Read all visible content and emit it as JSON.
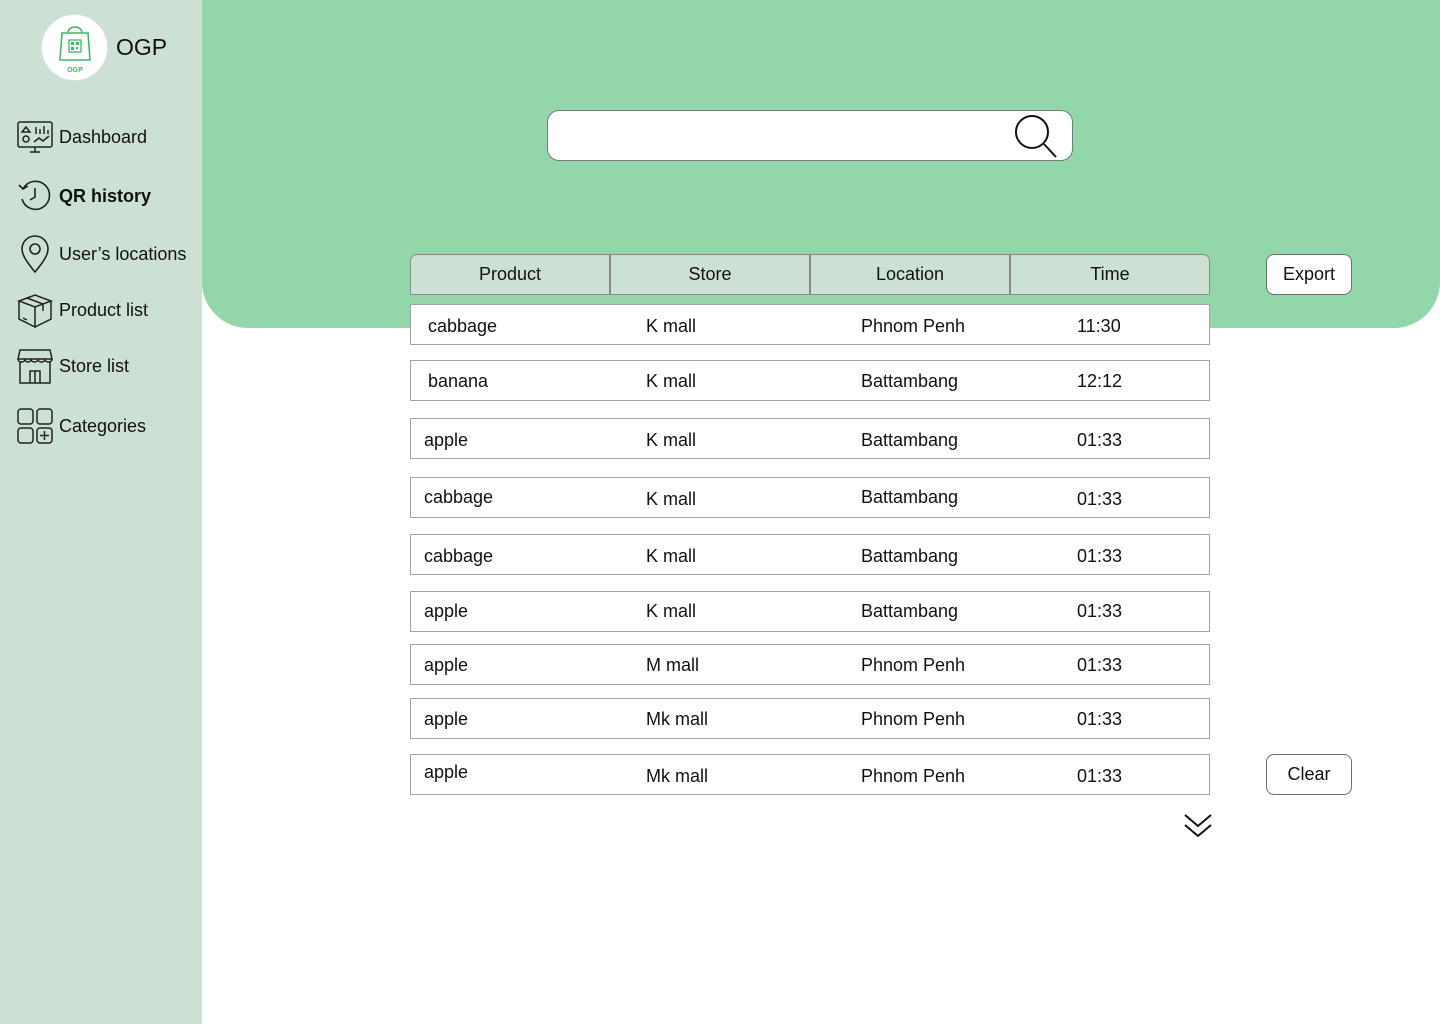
{
  "app": {
    "name": "OGP",
    "logo_text": "OGP",
    "accent": "#93d6aa",
    "sidebar_bg": "#cce0d3"
  },
  "sidebar": {
    "items": [
      {
        "label": "Dashboard",
        "icon": "dashboard-icon"
      },
      {
        "label": "QR history",
        "icon": "history-icon",
        "active": true
      },
      {
        "label": "User’s locations",
        "icon": "location-pin-icon"
      },
      {
        "label": "Product list",
        "icon": "box-icon"
      },
      {
        "label": "Store list",
        "icon": "store-icon"
      },
      {
        "label": "Categories",
        "icon": "categories-icon"
      }
    ]
  },
  "search": {
    "value": "",
    "placeholder": "",
    "icon": "search-icon"
  },
  "table": {
    "headers": [
      "Product",
      "Store",
      "Location",
      "Time"
    ],
    "rows": [
      [
        "cabbage",
        "K mall",
        "Phnom Penh",
        "11:30"
      ],
      [
        "banana",
        "K mall",
        "Battambang",
        "12:12"
      ],
      [
        "apple",
        "K mall",
        "Battambang",
        "01:33"
      ],
      [
        "cabbage",
        "K mall",
        "Battambang",
        "01:33"
      ],
      [
        "cabbage",
        "K mall",
        "Battambang",
        "01:33"
      ],
      [
        "apple",
        "K mall",
        "Battambang",
        "01:33"
      ],
      [
        "apple",
        "M mall",
        "Phnom Penh",
        "01:33"
      ],
      [
        "apple",
        "Mk mall",
        "Phnom Penh",
        "01:33"
      ],
      [
        "apple",
        "Mk mall",
        "Phnom Penh",
        "01:33"
      ]
    ]
  },
  "actions": {
    "export_label": "Export",
    "clear_label": "Clear",
    "more_icon": "double-chevron-down-icon"
  }
}
